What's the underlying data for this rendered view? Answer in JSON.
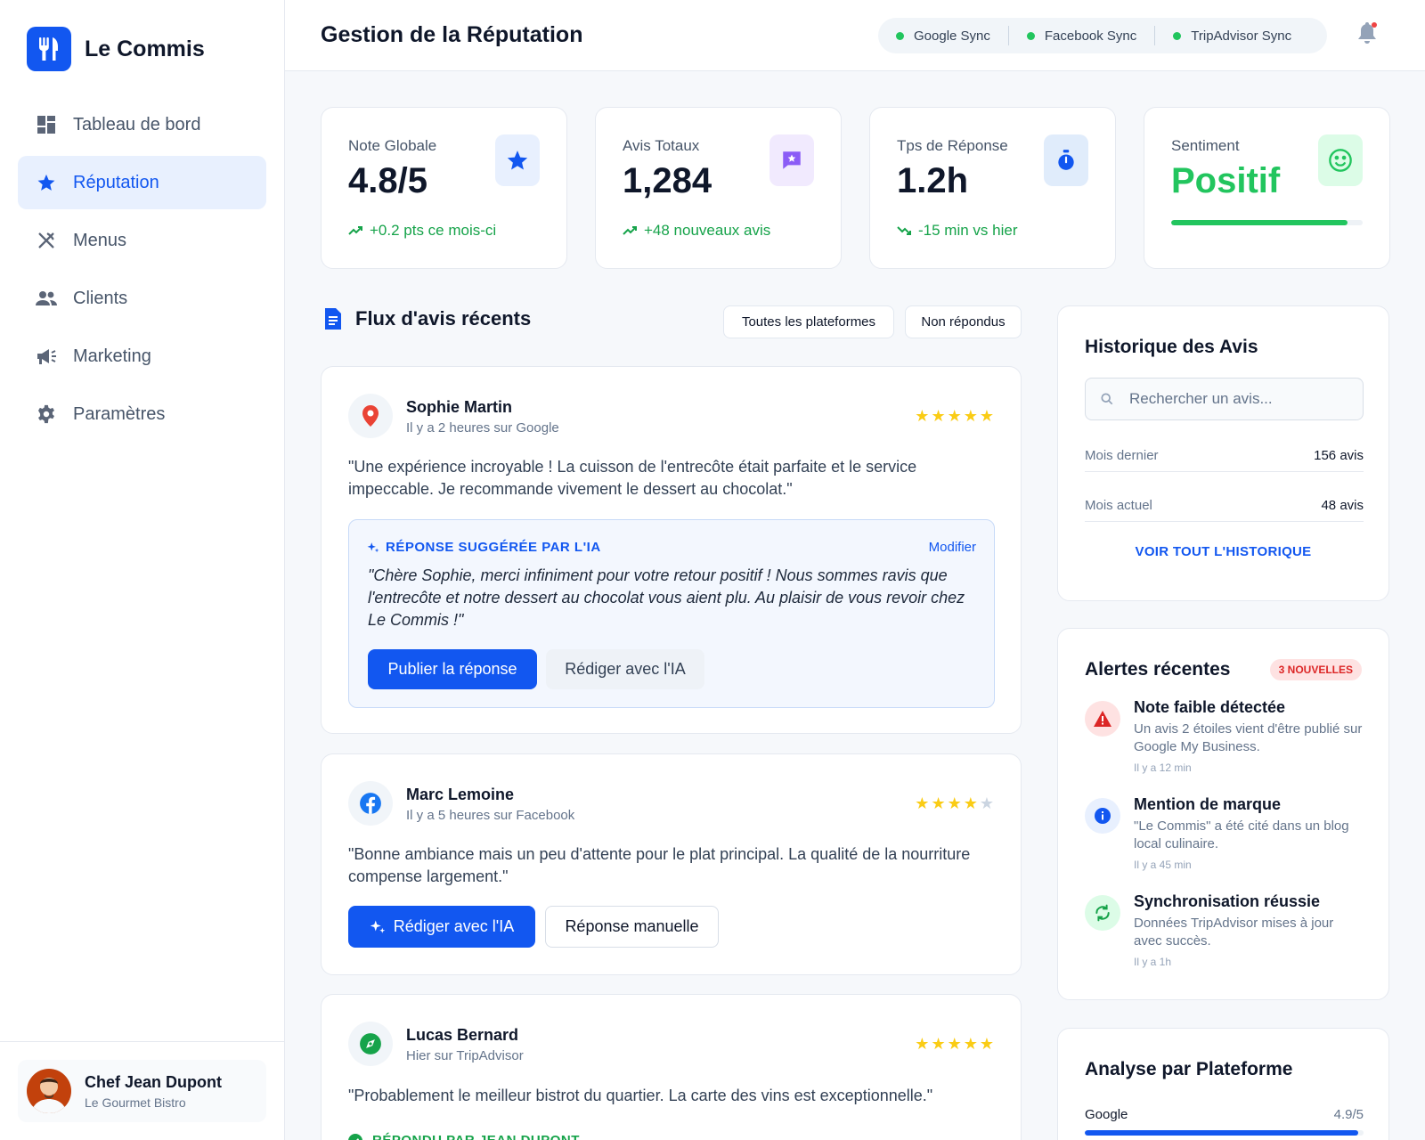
{
  "brand": {
    "name": "Le Commis"
  },
  "nav": [
    {
      "label": "Tableau de bord",
      "icon": "dashboard-icon"
    },
    {
      "label": "Réputation",
      "icon": "star-icon",
      "active": true
    },
    {
      "label": "Menus",
      "icon": "utensils-icon"
    },
    {
      "label": "Clients",
      "icon": "users-icon"
    },
    {
      "label": "Marketing",
      "icon": "megaphone-icon"
    },
    {
      "label": "Paramètres",
      "icon": "gear-icon"
    }
  ],
  "profile": {
    "name": "Chef Jean Dupont",
    "subtitle": "Le Gourmet Bistro"
  },
  "header": {
    "title": "Gestion de la Réputation",
    "syncs": [
      "Google Sync",
      "Facebook Sync",
      "TripAdvisor Sync"
    ]
  },
  "stats": {
    "rating": {
      "label": "Note Globale",
      "value": "4.8/5",
      "trend": "+0.2 pts ce mois-ci"
    },
    "total": {
      "label": "Avis Totaux",
      "value": "1,284",
      "trend": "+48 nouveaux avis"
    },
    "response": {
      "label": "Tps de Réponse",
      "value": "1.2h",
      "trend": "-15 min vs hier"
    },
    "sentiment": {
      "label": "Sentiment",
      "value": "Positif",
      "level": 0.92
    }
  },
  "feed": {
    "title": "Flux d'avis récents",
    "filters": [
      "Toutes les plateformes",
      "Non répondus"
    ],
    "reviews": [
      {
        "name": "Sophie Martin",
        "meta": "Il y a 2 heures sur Google",
        "stars": 5,
        "text": "\"Une expérience incroyable ! La cuisson de l'entrecôte était parfaite et le service impeccable. Je recommande vivement le dessert au chocolat.\"",
        "ai_label": "RÉPONSE SUGGÉRÉE PAR L'IA",
        "ai_edit": "Modifier",
        "ai_text": "\"Chère Sophie, merci infiniment pour votre retour positif ! Nous sommes ravis que l'entrecôte et notre dessert au chocolat vous aient plu. Au plaisir de vous revoir chez Le Commis !\"",
        "publish": "Publier la réponse",
        "rewrite": "Rédiger avec l'IA"
      },
      {
        "name": "Marc Lemoine",
        "meta": "Il y a 5 heures sur Facebook",
        "stars": 4,
        "text": "\"Bonne ambiance mais un peu d'attente pour le plat principal. La qualité de la nourriture compense largement.\"",
        "ai_button": "Rédiger avec l'IA",
        "manual": "Réponse manuelle"
      },
      {
        "name": "Lucas Bernard",
        "meta": "Hier sur TripAdvisor",
        "stars": 5,
        "text": "\"Probablement le meilleur bistrot du quartier. La carte des vins est exceptionnelle.\"",
        "replied": "RÉPONDU PAR JEAN DUPONT"
      }
    ]
  },
  "history": {
    "title": "Historique des Avis",
    "search_placeholder": "Rechercher un avis...",
    "rows": [
      {
        "label": "Mois dernier",
        "value": "156 avis"
      },
      {
        "label": "Mois actuel",
        "value": "48 avis"
      }
    ],
    "link": "VOIR TOUT L'HISTORIQUE"
  },
  "alerts": {
    "title": "Alertes récentes",
    "badge": "3 NOUVELLES",
    "items": [
      {
        "icon": "warning-icon",
        "title": "Note faible détectée",
        "text": "Un avis 2 étoiles vient d'être publié sur Google My Business.",
        "time": "Il y a 12 min"
      },
      {
        "icon": "info-icon",
        "title": "Mention de marque",
        "text": "\"Le Commis\" a été cité dans un blog local culinaire.",
        "time": "Il y a 45 min"
      },
      {
        "icon": "sync-icon",
        "title": "Synchronisation réussie",
        "text": "Données TripAdvisor mises à jour avec succès.",
        "time": "Il y a 1h"
      }
    ]
  },
  "platforms": {
    "title": "Analyse par Plateforme",
    "items": [
      {
        "name": "Google",
        "value": "4.9/5",
        "level": 0.98
      }
    ]
  },
  "colors": {
    "primary": "#1257f0",
    "success": "#22c55e",
    "danger": "#dc2626",
    "star": "#facc15"
  }
}
